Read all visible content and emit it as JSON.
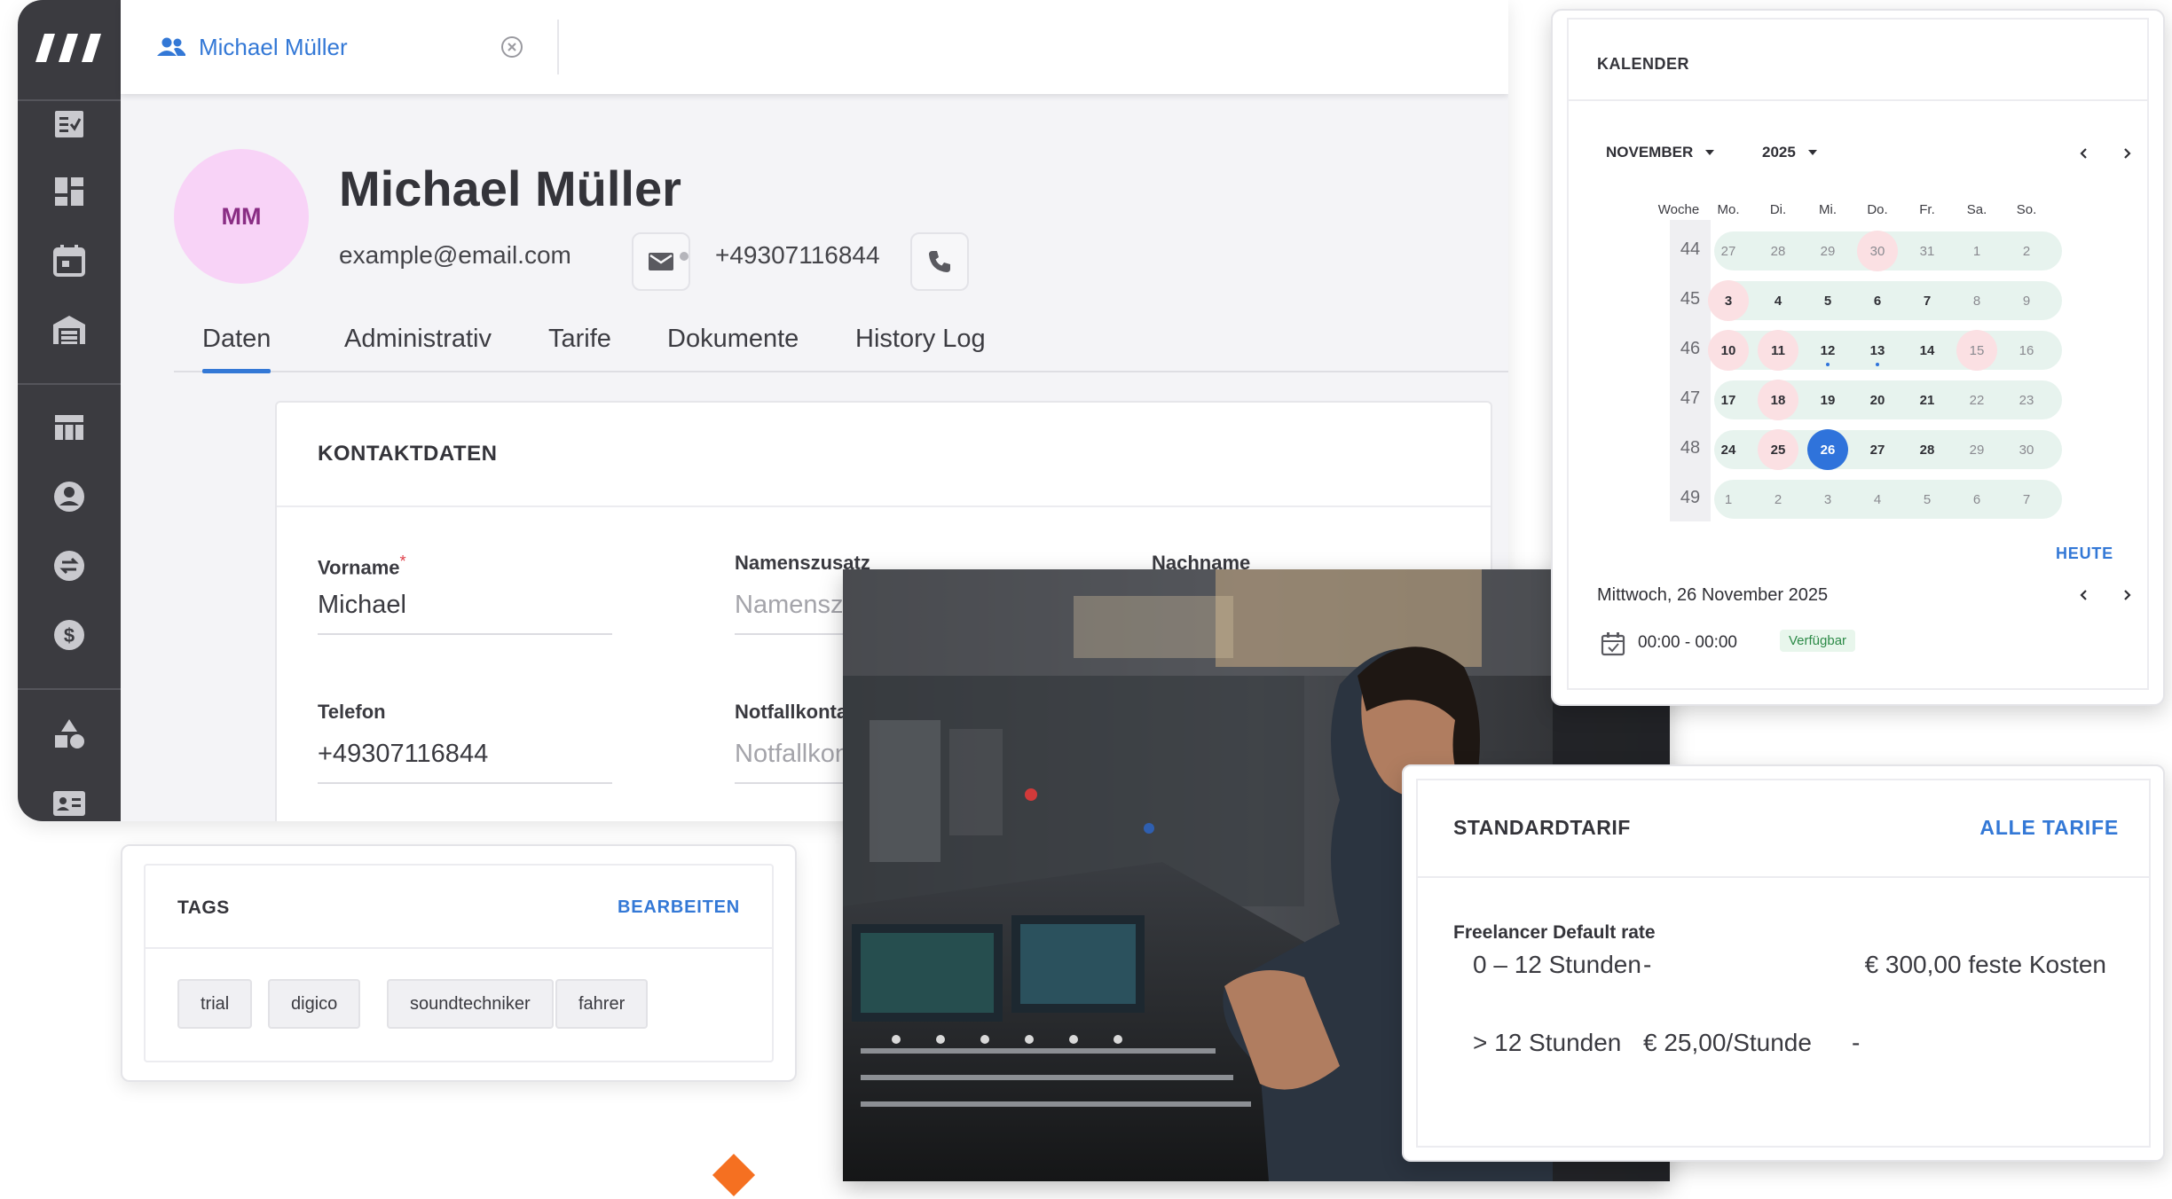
{
  "tab": {
    "title": "Michael Müller"
  },
  "profile": {
    "initials": "MM",
    "name": "Michael Müller",
    "email": "example@email.com",
    "phone": "+49307116844"
  },
  "nav_tabs": [
    "Daten",
    "Administrativ",
    "Tarife",
    "Dokumente",
    "History Log"
  ],
  "contact": {
    "title": "KONTAKTDATEN",
    "vorname_label": "Vorname",
    "required_mark": "*",
    "vorname_value": "Michael",
    "namenszusatz_label": "Namenszusatz",
    "namenszusatz_placeholder": "Namenszusatz",
    "nachname_label": "Nachname",
    "telefon_label": "Telefon",
    "telefon_value": "+49307116844",
    "notfall_label": "Notfallkontakt",
    "notfall_placeholder": "Notfallkontakt"
  },
  "tags": {
    "title": "TAGS",
    "edit": "BEARBEITEN",
    "items": [
      "trial",
      "digico",
      "soundtechniker",
      "fahrer"
    ]
  },
  "calendar": {
    "title": "KALENDER",
    "month": "NOVEMBER",
    "year": "2025",
    "weekday_header": [
      "Woche",
      "Mo.",
      "Di.",
      "Mi.",
      "Do.",
      "Fr.",
      "Sa.",
      "So."
    ],
    "weeks": [
      {
        "week": "44",
        "days": [
          "27",
          "28",
          "29",
          "30",
          "31",
          "1",
          "2"
        ]
      },
      {
        "week": "45",
        "days": [
          "3",
          "4",
          "5",
          "6",
          "7",
          "8",
          "9"
        ]
      },
      {
        "week": "46",
        "days": [
          "10",
          "11",
          "12",
          "13",
          "14",
          "15",
          "16"
        ]
      },
      {
        "week": "47",
        "days": [
          "17",
          "18",
          "19",
          "20",
          "21",
          "22",
          "23"
        ]
      },
      {
        "week": "48",
        "days": [
          "24",
          "25",
          "26",
          "27",
          "28",
          "29",
          "30"
        ]
      },
      {
        "week": "49",
        "days": [
          "1",
          "2",
          "3",
          "4",
          "5",
          "6",
          "7"
        ]
      }
    ],
    "today_label": "HEUTE",
    "selected_date": "Mittwoch, 26 November 2025",
    "slot_time": "00:00 - 00:00",
    "slot_status": "Verfügbar"
  },
  "tariff": {
    "title": "STANDARDTARIF",
    "all_link": "ALLE TARIFE",
    "rate_name": "Freelancer Default rate",
    "rows": [
      [
        "0 – 12 Stunden",
        "-",
        "€ 300,00 feste Kosten"
      ],
      [
        "> 12 Stunden",
        "€ 25,00/Stunde",
        "-"
      ]
    ]
  },
  "colors": {
    "accent": "#3378d6",
    "sidebar": "#3b3b40",
    "avatar_bg": "#f8d3f7",
    "available": "#2c8a47",
    "today": "#2f73db"
  }
}
